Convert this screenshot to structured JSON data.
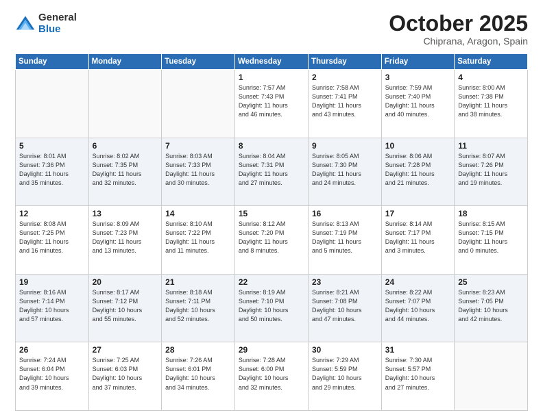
{
  "logo": {
    "general": "General",
    "blue": "Blue"
  },
  "title": "October 2025",
  "subtitle": "Chiprana, Aragon, Spain",
  "weekdays": [
    "Sunday",
    "Monday",
    "Tuesday",
    "Wednesday",
    "Thursday",
    "Friday",
    "Saturday"
  ],
  "weeks": [
    [
      {
        "day": "",
        "info": ""
      },
      {
        "day": "",
        "info": ""
      },
      {
        "day": "",
        "info": ""
      },
      {
        "day": "1",
        "info": "Sunrise: 7:57 AM\nSunset: 7:43 PM\nDaylight: 11 hours\nand 46 minutes."
      },
      {
        "day": "2",
        "info": "Sunrise: 7:58 AM\nSunset: 7:41 PM\nDaylight: 11 hours\nand 43 minutes."
      },
      {
        "day": "3",
        "info": "Sunrise: 7:59 AM\nSunset: 7:40 PM\nDaylight: 11 hours\nand 40 minutes."
      },
      {
        "day": "4",
        "info": "Sunrise: 8:00 AM\nSunset: 7:38 PM\nDaylight: 11 hours\nand 38 minutes."
      }
    ],
    [
      {
        "day": "5",
        "info": "Sunrise: 8:01 AM\nSunset: 7:36 PM\nDaylight: 11 hours\nand 35 minutes."
      },
      {
        "day": "6",
        "info": "Sunrise: 8:02 AM\nSunset: 7:35 PM\nDaylight: 11 hours\nand 32 minutes."
      },
      {
        "day": "7",
        "info": "Sunrise: 8:03 AM\nSunset: 7:33 PM\nDaylight: 11 hours\nand 30 minutes."
      },
      {
        "day": "8",
        "info": "Sunrise: 8:04 AM\nSunset: 7:31 PM\nDaylight: 11 hours\nand 27 minutes."
      },
      {
        "day": "9",
        "info": "Sunrise: 8:05 AM\nSunset: 7:30 PM\nDaylight: 11 hours\nand 24 minutes."
      },
      {
        "day": "10",
        "info": "Sunrise: 8:06 AM\nSunset: 7:28 PM\nDaylight: 11 hours\nand 21 minutes."
      },
      {
        "day": "11",
        "info": "Sunrise: 8:07 AM\nSunset: 7:26 PM\nDaylight: 11 hours\nand 19 minutes."
      }
    ],
    [
      {
        "day": "12",
        "info": "Sunrise: 8:08 AM\nSunset: 7:25 PM\nDaylight: 11 hours\nand 16 minutes."
      },
      {
        "day": "13",
        "info": "Sunrise: 8:09 AM\nSunset: 7:23 PM\nDaylight: 11 hours\nand 13 minutes."
      },
      {
        "day": "14",
        "info": "Sunrise: 8:10 AM\nSunset: 7:22 PM\nDaylight: 11 hours\nand 11 minutes."
      },
      {
        "day": "15",
        "info": "Sunrise: 8:12 AM\nSunset: 7:20 PM\nDaylight: 11 hours\nand 8 minutes."
      },
      {
        "day": "16",
        "info": "Sunrise: 8:13 AM\nSunset: 7:19 PM\nDaylight: 11 hours\nand 5 minutes."
      },
      {
        "day": "17",
        "info": "Sunrise: 8:14 AM\nSunset: 7:17 PM\nDaylight: 11 hours\nand 3 minutes."
      },
      {
        "day": "18",
        "info": "Sunrise: 8:15 AM\nSunset: 7:15 PM\nDaylight: 11 hours\nand 0 minutes."
      }
    ],
    [
      {
        "day": "19",
        "info": "Sunrise: 8:16 AM\nSunset: 7:14 PM\nDaylight: 10 hours\nand 57 minutes."
      },
      {
        "day": "20",
        "info": "Sunrise: 8:17 AM\nSunset: 7:12 PM\nDaylight: 10 hours\nand 55 minutes."
      },
      {
        "day": "21",
        "info": "Sunrise: 8:18 AM\nSunset: 7:11 PM\nDaylight: 10 hours\nand 52 minutes."
      },
      {
        "day": "22",
        "info": "Sunrise: 8:19 AM\nSunset: 7:10 PM\nDaylight: 10 hours\nand 50 minutes."
      },
      {
        "day": "23",
        "info": "Sunrise: 8:21 AM\nSunset: 7:08 PM\nDaylight: 10 hours\nand 47 minutes."
      },
      {
        "day": "24",
        "info": "Sunrise: 8:22 AM\nSunset: 7:07 PM\nDaylight: 10 hours\nand 44 minutes."
      },
      {
        "day": "25",
        "info": "Sunrise: 8:23 AM\nSunset: 7:05 PM\nDaylight: 10 hours\nand 42 minutes."
      }
    ],
    [
      {
        "day": "26",
        "info": "Sunrise: 7:24 AM\nSunset: 6:04 PM\nDaylight: 10 hours\nand 39 minutes."
      },
      {
        "day": "27",
        "info": "Sunrise: 7:25 AM\nSunset: 6:03 PM\nDaylight: 10 hours\nand 37 minutes."
      },
      {
        "day": "28",
        "info": "Sunrise: 7:26 AM\nSunset: 6:01 PM\nDaylight: 10 hours\nand 34 minutes."
      },
      {
        "day": "29",
        "info": "Sunrise: 7:28 AM\nSunset: 6:00 PM\nDaylight: 10 hours\nand 32 minutes."
      },
      {
        "day": "30",
        "info": "Sunrise: 7:29 AM\nSunset: 5:59 PM\nDaylight: 10 hours\nand 29 minutes."
      },
      {
        "day": "31",
        "info": "Sunrise: 7:30 AM\nSunset: 5:57 PM\nDaylight: 10 hours\nand 27 minutes."
      },
      {
        "day": "",
        "info": ""
      }
    ]
  ]
}
